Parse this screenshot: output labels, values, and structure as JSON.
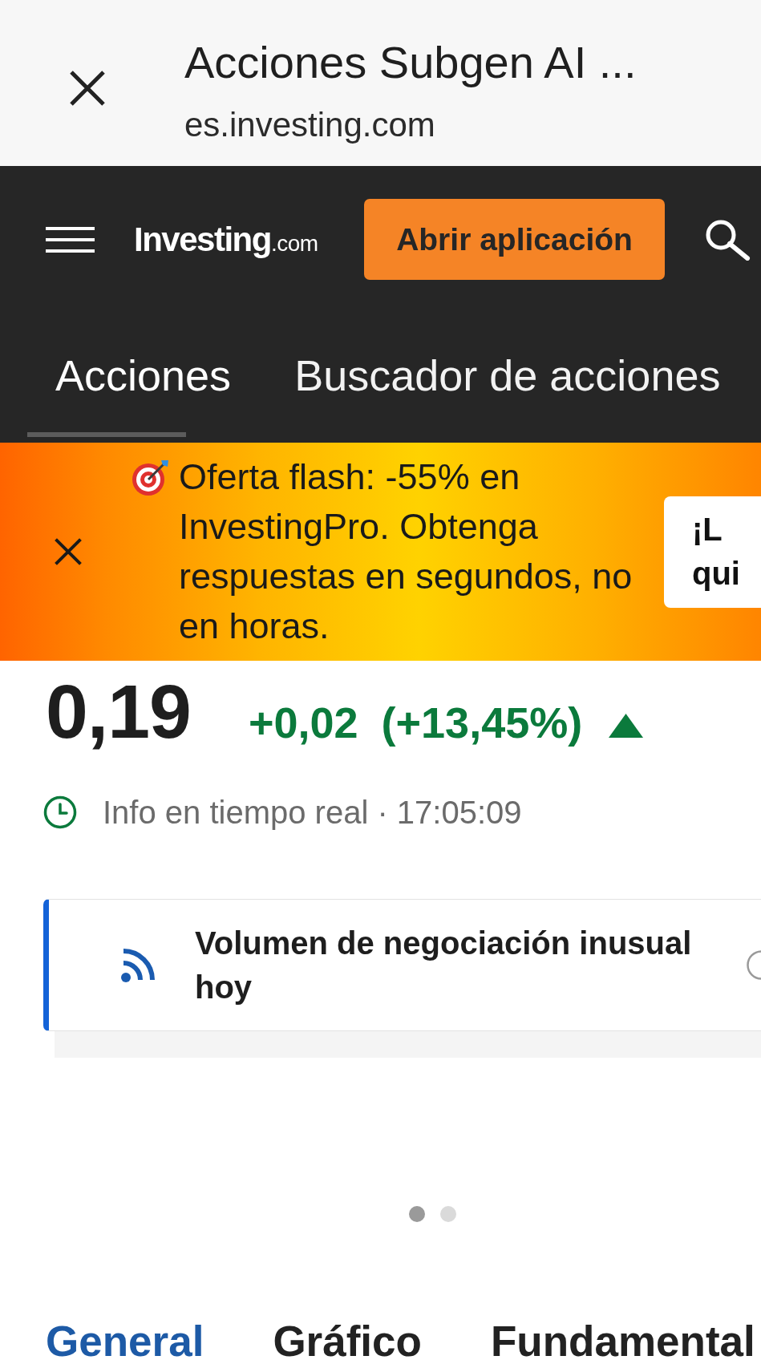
{
  "browser_bar": {
    "title": "Acciones Subgen AI ...",
    "url": "es.investing.com"
  },
  "header": {
    "logo": {
      "name": "Investing",
      "suffix": ".com"
    },
    "open_app_button": "Abrir aplicación"
  },
  "nav_tabs": [
    {
      "label": "Acciones",
      "selected": true
    },
    {
      "label": "Buscador de acciones",
      "selected": false
    }
  ],
  "promo_banner": {
    "text": "Oferta flash: -55% en InvestingPro. Obtenga respuestas en segundos, no en horas.",
    "button_lines": [
      "¡L",
      "qui"
    ]
  },
  "quote": {
    "price": "0,19",
    "change": "+0,02",
    "change_percent": "(+13,45%)",
    "rising": true,
    "status": "Info en tiempo real · 17:05:09"
  },
  "alert_card": {
    "text": "Volumen de negociación inusual hoy"
  },
  "carousel_dots": [
    {
      "selected": true
    },
    {
      "selected": false
    }
  ],
  "section_tabs": [
    {
      "label": "General",
      "selected": true
    },
    {
      "label": "Gráfico",
      "selected": false
    },
    {
      "label": "Fundamental",
      "selected": false
    }
  ]
}
